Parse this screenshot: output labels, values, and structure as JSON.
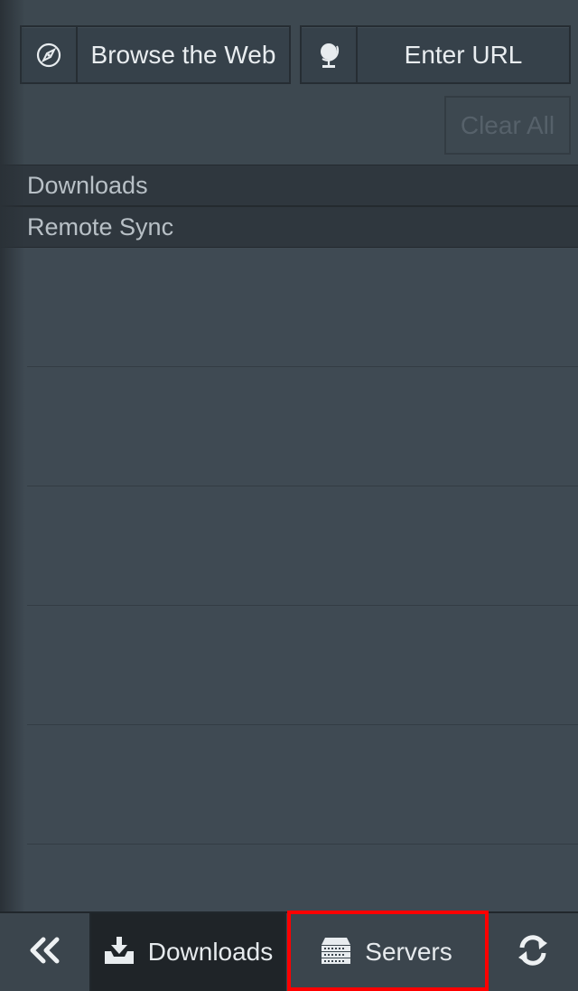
{
  "toolbar": {
    "browse_label": "Browse the Web",
    "browse_icon": "compass-icon",
    "url_label": "Enter URL",
    "url_icon": "globe-icon",
    "clear_label": "Clear All"
  },
  "sections": [
    {
      "label": "Downloads"
    },
    {
      "label": "Remote Sync"
    }
  ],
  "tabs": [
    {
      "label": "",
      "icon": "double-chevron-left-icon"
    },
    {
      "label": "Downloads",
      "icon": "download-tray-icon",
      "selected": true
    },
    {
      "label": "Servers",
      "icon": "server-icon"
    },
    {
      "label": "",
      "icon": "refresh-icon"
    }
  ],
  "colors": {
    "background": "#3f4a53",
    "section_header": "#2f373e",
    "selected_tab": "#1f2428",
    "highlight": "#ff0000"
  }
}
